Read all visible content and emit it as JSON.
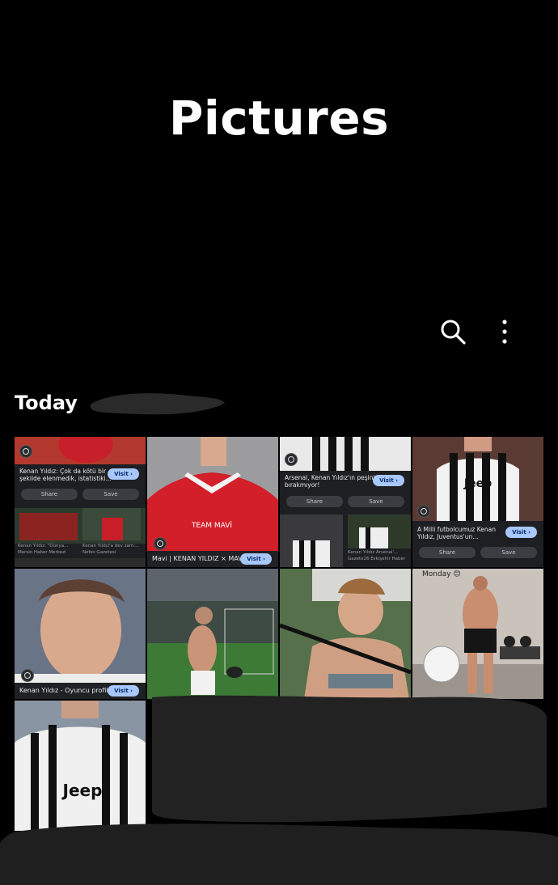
{
  "header": {
    "title": "Pictures"
  },
  "toolbar": {
    "search_icon": "search-icon",
    "more_icon": "more-vert-icon"
  },
  "section": {
    "label": "Today"
  },
  "tiles": {
    "t1": {
      "caption": "Kenan Yıldız: Çok da kötü bir şekilde elenmedik, istatistiki...",
      "visit": "Visit ›",
      "share": "Share",
      "save": "Save",
      "sub1_title": "Kenan Yıldız: \"Dünya...",
      "sub1_source": "Mersin Haber Merkezi",
      "sub2_title": "Kenan Yıldız'a dev zam:...",
      "sub2_source": "Nefes Gazetesi"
    },
    "t2": {
      "caption": "Mavi | KENAN YILDIZ × MAVİ |",
      "visit": "Visit ›"
    },
    "t3": {
      "caption": "Arsenal, Kenan Yıldız'ın peşini bırakmıyor!",
      "visit": "Visit ›",
      "share": "Share",
      "save": "Save",
      "sub1_source": "",
      "sub2_title": "Kenan Yıldız Arsenal'...",
      "sub2_source": "Gazete26 Eskişehir Haber"
    },
    "t4": {
      "caption": "A Milli futbolcumuz Kenan Yıldız, Juventus'un...",
      "visit": "Visit ›",
      "share": "Share",
      "save": "Save"
    },
    "t5": {
      "caption": "Kenan Yıldız - Oyuncu profili",
      "visit": "Visit ›"
    },
    "t8": {
      "story_text": "Monday 😊"
    }
  },
  "colors": {
    "background": "#000000",
    "visit_button": "#a8c7fa",
    "card": "#202124"
  }
}
